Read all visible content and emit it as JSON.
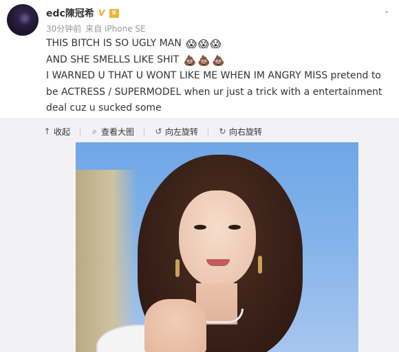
{
  "post": {
    "username": "edc陳冠希",
    "badge_v": "V",
    "meta": {
      "time": "30分钟前",
      "source": "来自 iPhone SE"
    },
    "lines": [
      "THIS BITCH IS SO UGLY MAN",
      "AND SHE SMELLS LIKE SHIT",
      "I WARNED U THAT U WONT LIKE ME WHEN IM ANGRY MISS pretend to be ACTRESS / SUPERMODEL when ur just a trick with a entertainment deal cuz u sucked some"
    ],
    "emoji": {
      "line1": [
        "😱",
        "😱",
        "😱"
      ],
      "line2": [
        "💩",
        "💩",
        "💩"
      ]
    }
  },
  "media": {
    "toolbar": [
      {
        "name": "collapse",
        "icon": "↑",
        "label": "收起"
      },
      {
        "name": "view-large",
        "icon": "⌕",
        "label": "查看大图"
      },
      {
        "name": "rotate-left",
        "icon": "↺",
        "label": "向左旋转"
      },
      {
        "name": "rotate-right",
        "icon": "↻",
        "label": "向右旋转"
      }
    ]
  },
  "icons": {
    "avatar": "avatar",
    "more": "chevron-down-icon",
    "collapse": "up-arrow-icon",
    "view": "search-icon",
    "rotate_left": "rotate-left-icon",
    "rotate_right": "rotate-right-icon"
  },
  "colors": {
    "text": "#333333",
    "meta": "#999999",
    "badge_v": "#f5a623",
    "media_bg": "#f2f2f5"
  }
}
